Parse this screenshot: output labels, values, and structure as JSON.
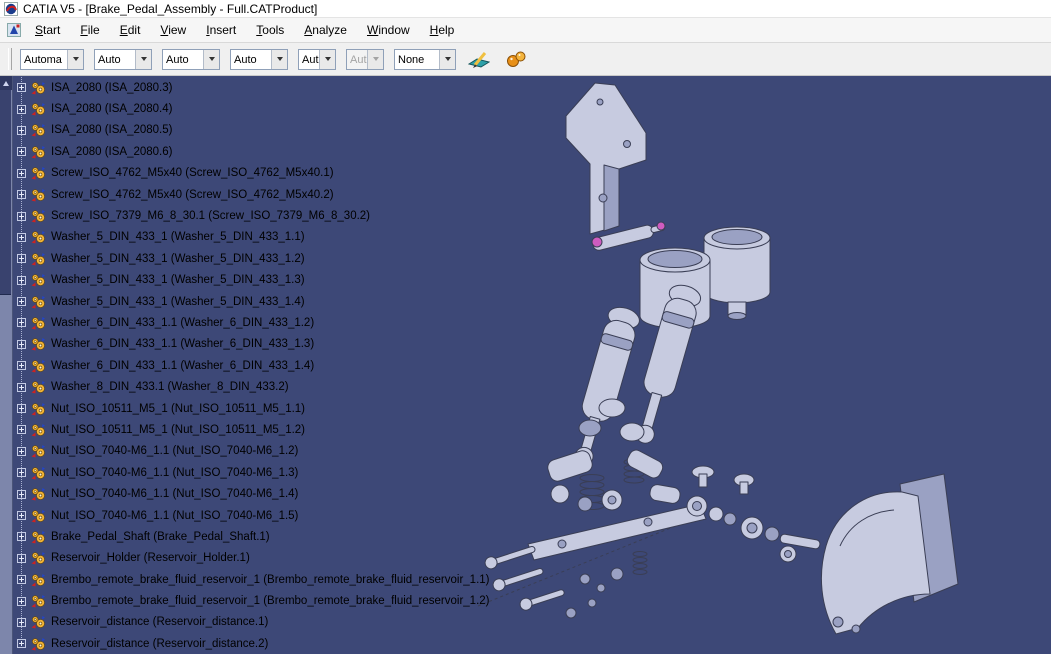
{
  "window": {
    "title": "CATIA V5 - [Brake_Pedal_Assembly - Full.CATProduct]"
  },
  "menu": {
    "items": [
      "Start",
      "File",
      "Edit",
      "View",
      "Insert",
      "Tools",
      "Analyze",
      "Window",
      "Help"
    ]
  },
  "toolbar": {
    "combos": [
      {
        "value": "Automa",
        "state": "enabled"
      },
      {
        "value": "Auto",
        "state": "enabled"
      },
      {
        "value": "Auto",
        "state": "enabled"
      },
      {
        "value": "Auto",
        "state": "enabled"
      },
      {
        "value": "Aut",
        "state": "enabled"
      },
      {
        "value": "Aut",
        "state": "disabled"
      },
      {
        "value": "None",
        "state": "enabled"
      }
    ],
    "icons": [
      "graphic-properties-pen-icon",
      "painter-spheres-icon"
    ]
  },
  "tree": {
    "items": [
      "ISA_2080 (ISA_2080.3)",
      "ISA_2080 (ISA_2080.4)",
      "ISA_2080 (ISA_2080.5)",
      "ISA_2080 (ISA_2080.6)",
      "Screw_ISO_4762_M5x40 (Screw_ISO_4762_M5x40.1)",
      "Screw_ISO_4762_M5x40 (Screw_ISO_4762_M5x40.2)",
      "Screw_ISO_7379_M6_8_30.1 (Screw_ISO_7379_M6_8_30.2)",
      "Washer_5_DIN_433_1 (Washer_5_DIN_433_1.1)",
      "Washer_5_DIN_433_1 (Washer_5_DIN_433_1.2)",
      "Washer_5_DIN_433_1 (Washer_5_DIN_433_1.3)",
      "Washer_5_DIN_433_1 (Washer_5_DIN_433_1.4)",
      "Washer_6_DIN_433_1.1 (Washer_6_DIN_433_1.2)",
      "Washer_6_DIN_433_1.1 (Washer_6_DIN_433_1.3)",
      "Washer_6_DIN_433_1.1 (Washer_6_DIN_433_1.4)",
      "Washer_8_DIN_433.1 (Washer_8_DIN_433.2)",
      "Nut_ISO_10511_M5_1 (Nut_ISO_10511_M5_1.1)",
      "Nut_ISO_10511_M5_1 (Nut_ISO_10511_M5_1.2)",
      "Nut_ISO_7040-M6_1.1 (Nut_ISO_7040-M6_1.2)",
      "Nut_ISO_7040-M6_1.1 (Nut_ISO_7040-M6_1.3)",
      "Nut_ISO_7040-M6_1.1 (Nut_ISO_7040-M6_1.4)",
      "Nut_ISO_7040-M6_1.1 (Nut_ISO_7040-M6_1.5)",
      "Brake_Pedal_Shaft (Brake_Pedal_Shaft.1)",
      "Reservoir_Holder (Reservoir_Holder.1)",
      "Brembo_remote_brake_fluid_reservoir_1 (Brembo_remote_brake_fluid_reservoir_1.1)",
      "Brembo_remote_brake_fluid_reservoir_1 (Brembo_remote_brake_fluid_reservoir_1.2)",
      "Reservoir_distance (Reservoir_distance.1)",
      "Reservoir_distance (Reservoir_distance.2)"
    ]
  },
  "viewport": {
    "background": "#3d4877",
    "part_fill": "#c7cbe0",
    "part_shade": "#9aa1c3",
    "part_stroke": "#3a3e55",
    "accent_magenta": "#cf5cc0"
  }
}
